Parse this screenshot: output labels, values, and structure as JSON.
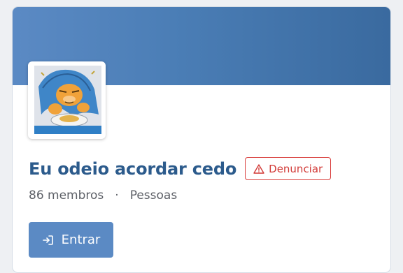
{
  "group": {
    "title": "Eu odeio acordar cedo",
    "members": "86 membros",
    "separator": "·",
    "category": "Pessoas"
  },
  "actions": {
    "report_label": "Denunciar",
    "join_label": "Entrar"
  },
  "icons": {
    "report": "warning-triangle-icon",
    "join": "sign-in-icon"
  },
  "colors": {
    "cover_start": "#5b8ac4",
    "cover_end": "#3a6a9f",
    "title": "#2c5b8c",
    "report": "#d23a37",
    "join_button": "#5b8ac4"
  }
}
